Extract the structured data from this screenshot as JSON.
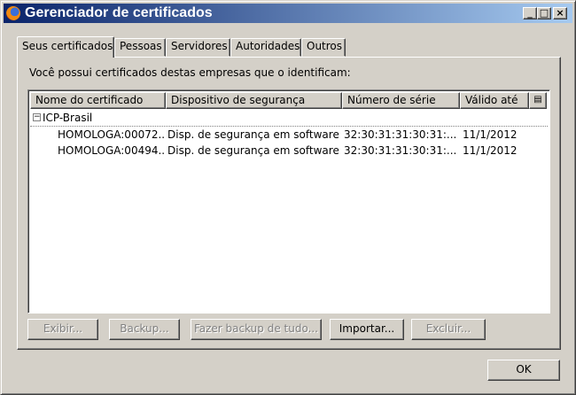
{
  "window": {
    "title": "Gerenciador de certificados"
  },
  "titlebar_buttons": {
    "minimize": "_",
    "maximize": "□",
    "close": "×"
  },
  "tabs": [
    {
      "label": "Seus certificados",
      "active": true
    },
    {
      "label": "Pessoas",
      "active": false
    },
    {
      "label": "Servidores",
      "active": false
    },
    {
      "label": "Autoridades",
      "active": false
    },
    {
      "label": "Outros",
      "active": false
    }
  ],
  "panel": {
    "intro": "Você possui certificados destas empresas que o identificam:"
  },
  "table": {
    "columns": [
      "Nome do certificado",
      "Dispositivo de segurança",
      "Número de série",
      "Válido até"
    ],
    "group": {
      "twisty": "−",
      "label": "ICP-Brasil"
    },
    "rows": [
      {
        "name": "HOMOLOGA:00072...",
        "device": "Disp. de segurança em software",
        "serial": "32:30:31:31:30:31:...",
        "valid": "11/1/2012"
      },
      {
        "name": "HOMOLOGA:00494...",
        "device": "Disp. de segurança em software",
        "serial": "32:30:31:31:30:31:...",
        "valid": "11/1/2012"
      }
    ]
  },
  "buttons": {
    "view": "Exibir...",
    "backup": "Backup...",
    "backup_all": "Fazer backup de tudo...",
    "import": "Importar...",
    "delete": "Excluir...",
    "ok": "OK"
  }
}
